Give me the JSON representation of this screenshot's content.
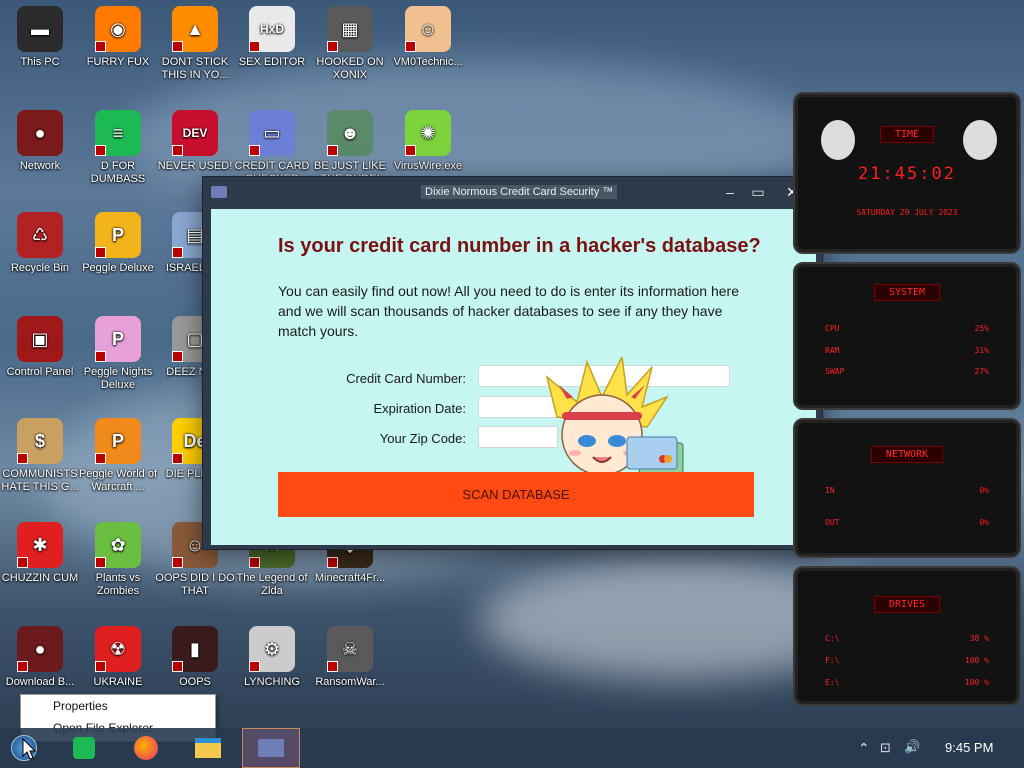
{
  "desktop_icons": [
    {
      "label": "This PC",
      "color": "#2b2b2b",
      "glyph": "▬"
    },
    {
      "label": "FURRY FUX",
      "color": "#ff7a00",
      "glyph": "◉"
    },
    {
      "label": "DONT STICK THIS IN YO...",
      "color": "#ff8c00",
      "glyph": "▲"
    },
    {
      "label": "SEX EDITOR",
      "color": "#e9e9e9",
      "glyph": "HxD"
    },
    {
      "label": "HOOKED ON XONIX",
      "color": "#5a5a5a",
      "glyph": "▦"
    },
    {
      "label": "VM0Technic...",
      "color": "#f0c090",
      "glyph": "☺"
    },
    {
      "label": "Network",
      "color": "#7a1a1a",
      "glyph": "●"
    },
    {
      "label": "D FOR DUMBASS",
      "color": "#1db954",
      "glyph": "≡"
    },
    {
      "label": "NEVER USED!",
      "color": "#c8102e",
      "glyph": "DEV"
    },
    {
      "label": "CREDIT CARD CHECKER",
      "color": "#6b7fd6",
      "glyph": "▭"
    },
    {
      "label": "BE JUST LIKE THE DUDE!",
      "color": "#5a8a6a",
      "glyph": "☻"
    },
    {
      "label": "VirusWire.exe",
      "color": "#7cd33b",
      "glyph": "✺"
    },
    {
      "label": "Recycle Bin",
      "color": "#b22222",
      "glyph": "♺"
    },
    {
      "label": "Peggle Deluxe",
      "color": "#f3b31a",
      "glyph": "P"
    },
    {
      "label": "ISRAEL S...",
      "color": "#8aa8d0",
      "glyph": "▤"
    },
    {
      "label": "Control Panel",
      "color": "#a01818",
      "glyph": "▣"
    },
    {
      "label": "Peggle Nights Deluxe",
      "color": "#e8a0d8",
      "glyph": "P"
    },
    {
      "label": "DEEZ NU...",
      "color": "#9a9a9a",
      "glyph": "▢"
    },
    {
      "label": "COMMUNISTS HATE THIS G...",
      "color": "#c8a060",
      "glyph": "$"
    },
    {
      "label": "Peggle World of Warcraft ...",
      "color": "#f08a1a",
      "glyph": "P"
    },
    {
      "label": "DIE PLEA...",
      "color": "#ffd000",
      "glyph": "De"
    },
    {
      "label": "CHUZZIN CUM",
      "color": "#e02020",
      "glyph": "✱"
    },
    {
      "label": "Plants vs Zombies",
      "color": "#6abf40",
      "glyph": "✿"
    },
    {
      "label": "OOPS DID I DO THAT",
      "color": "#8a5a3a",
      "glyph": "☺"
    },
    {
      "label": "The Legend of Zlda",
      "color": "#4a6a2a",
      "glyph": "⚔"
    },
    {
      "label": "Minecraft4Fr...",
      "color": "#3a2a1a",
      "glyph": "◆"
    },
    {
      "label": "Download B...",
      "color": "#6a1a1a",
      "glyph": "●"
    },
    {
      "label": "UKRAINE",
      "color": "#e02020",
      "glyph": "☢"
    },
    {
      "label": "OOPS",
      "color": "#3a1a1a",
      "glyph": "▮"
    },
    {
      "label": "LYNCHING",
      "color": "#cccccc",
      "glyph": "⚙"
    },
    {
      "label": "RansomWar...",
      "color": "#5a5a5a",
      "glyph": "☠"
    }
  ],
  "dialog": {
    "title": "Dixie Normous Credit Card Security ™",
    "minimize": "–",
    "maximize": "▭",
    "close": "✕",
    "headline": "Is your credit card number in a hacker's database?",
    "intro": "You can easily find out now! All you need to do is enter its information here and we will scan thousands of hacker databases to see if any they have match yours.",
    "fields": [
      {
        "label": "Credit Card Number:",
        "value": ""
      },
      {
        "label": "Expiration Date:",
        "value": ""
      },
      {
        "label": "Your Zip Code:",
        "value": ""
      }
    ],
    "scan_button": "SCAN DATABASE"
  },
  "widget": {
    "time_title": "TIME",
    "time": "21:45:02",
    "date": "SATURDAY 29 JULY 2023",
    "system_title": "SYSTEM",
    "system_rows": [
      {
        "label": "CPU",
        "value": "25%"
      },
      {
        "label": "RAM",
        "value": "31%"
      },
      {
        "label": "SWAP",
        "value": "27%"
      }
    ],
    "network_title": "NETWORK",
    "network_rows": [
      {
        "label": "IN",
        "value": "0%"
      },
      {
        "label": "OUT",
        "value": "0%"
      }
    ],
    "drives_title": "DRIVES",
    "drives_rows": [
      {
        "label": "C:\\",
        "value": "38 %"
      },
      {
        "label": "F:\\",
        "value": "100 %"
      },
      {
        "label": "E:\\",
        "value": "100 %"
      }
    ]
  },
  "context_menu": {
    "items": [
      "Properties",
      "Open File Explorer"
    ]
  },
  "taskbar": {
    "clock": "9:45 PM",
    "tray_up": "⌃",
    "network_icon": "⊡",
    "volume_icon": "🔊"
  }
}
